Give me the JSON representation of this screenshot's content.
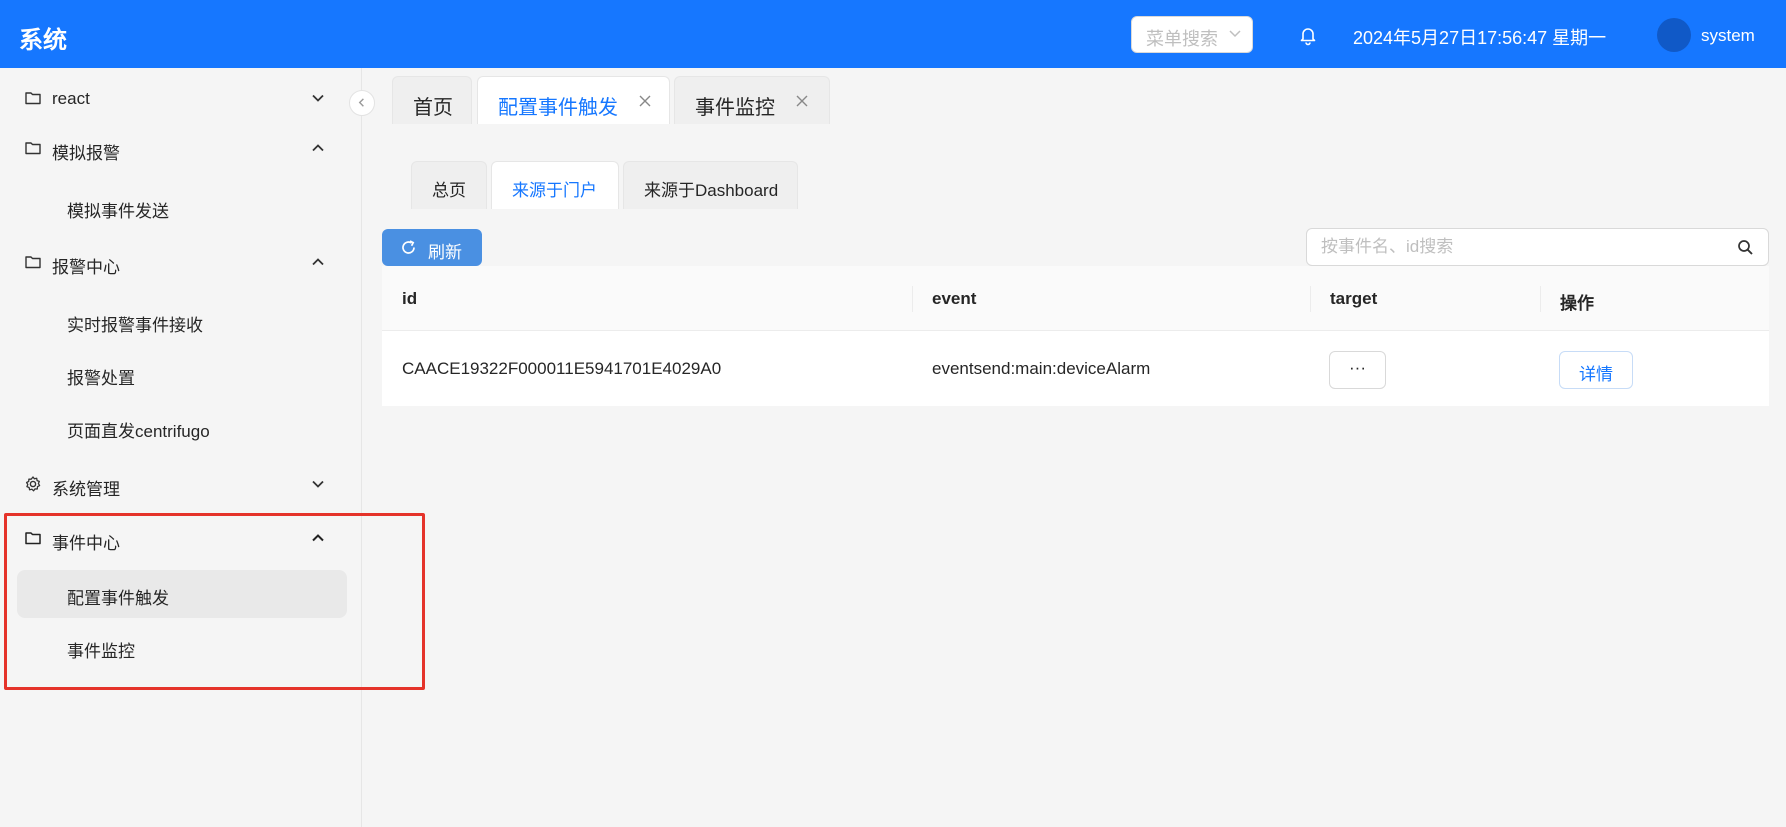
{
  "header": {
    "app_title": "系统",
    "menu_search_placeholder": "菜单搜索",
    "datetime": "2024年5月27日17:56:47 星期一",
    "username": "system",
    "brand_color": "#1677ff"
  },
  "sidebar": {
    "groups": [
      {
        "label": "react",
        "icon": "folder-icon",
        "expanded": false
      },
      {
        "label": "模拟报警",
        "icon": "folder-icon",
        "expanded": true,
        "items": [
          "模拟事件发送"
        ]
      },
      {
        "label": "报警中心",
        "icon": "folder-icon",
        "expanded": true,
        "items": [
          "实时报警事件接收",
          "报警处置",
          "页面直发centrifugo"
        ]
      },
      {
        "label": "系统管理",
        "icon": "gear-icon",
        "expanded": false
      },
      {
        "label": "事件中心",
        "icon": "folder-icon",
        "expanded": true,
        "items": [
          "配置事件触发",
          "事件监控"
        ]
      }
    ],
    "active_item": "配置事件触发"
  },
  "page_tabs": [
    {
      "label": "首页",
      "closable": false
    },
    {
      "label": "配置事件触发",
      "closable": true,
      "active": true
    },
    {
      "label": "事件监控",
      "closable": true
    }
  ],
  "sub_tabs": [
    {
      "label": "总页"
    },
    {
      "label": "来源于门户",
      "active": true
    },
    {
      "label": "来源于Dashboard"
    }
  ],
  "toolbar": {
    "refresh_label": "刷新",
    "search_placeholder": "按事件名、id搜索"
  },
  "table": {
    "columns": [
      "id",
      "event",
      "target",
      "操作"
    ],
    "rows": [
      {
        "id": "CAACE19322F000011E5941701E4029A0",
        "event": "eventsend:main:deviceAlarm",
        "target": "···",
        "action": "详情"
      }
    ]
  }
}
